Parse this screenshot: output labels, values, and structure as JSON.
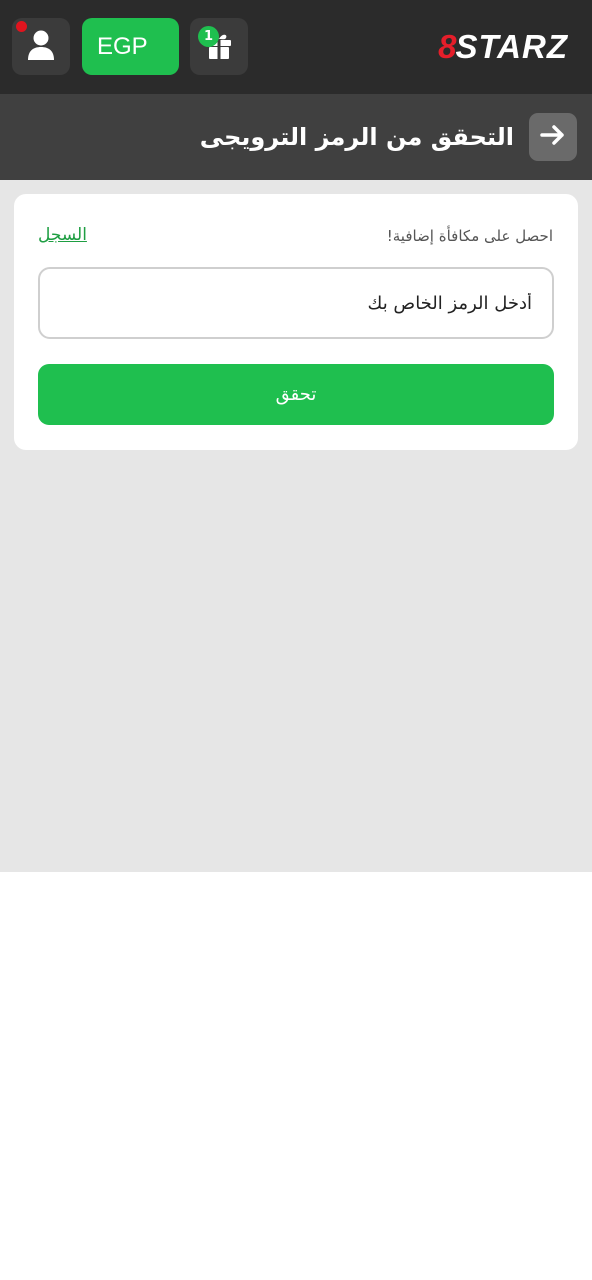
{
  "header": {
    "currency": "EGP",
    "gift_badge_count": "1",
    "logo_mark": "8",
    "logo_text": "STARZ",
    "colors": {
      "bar": "#2b2b2b",
      "accent": "#1fbf4f",
      "logo_red": "#e51e2a"
    }
  },
  "subheader": {
    "title": "التحقق من الرمز الترويجى"
  },
  "promo_card": {
    "hint": "احصل على مكافأة إضافية!",
    "register_link": "السجل",
    "input_placeholder": "أدخل الرمز الخاص بك",
    "input_value": "",
    "submit_label": "تحقق"
  },
  "icons": {
    "profile": "user-icon",
    "gift": "gift-icon",
    "back": "arrow-right-icon"
  }
}
